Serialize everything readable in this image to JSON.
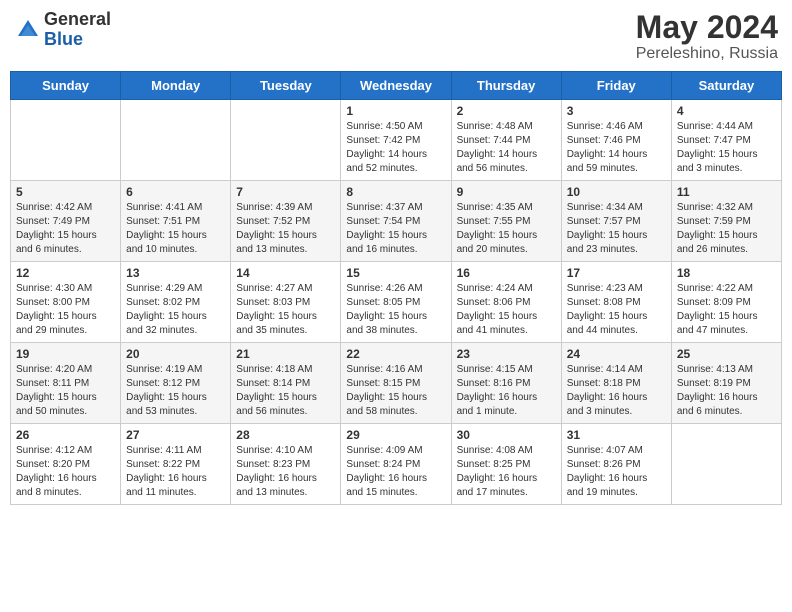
{
  "header": {
    "logo_general": "General",
    "logo_blue": "Blue",
    "title": "May 2024",
    "location": "Pereleshino, Russia"
  },
  "days_of_week": [
    "Sunday",
    "Monday",
    "Tuesday",
    "Wednesday",
    "Thursday",
    "Friday",
    "Saturday"
  ],
  "weeks": [
    [
      {
        "day": "",
        "info": ""
      },
      {
        "day": "",
        "info": ""
      },
      {
        "day": "",
        "info": ""
      },
      {
        "day": "1",
        "info": "Sunrise: 4:50 AM\nSunset: 7:42 PM\nDaylight: 14 hours\nand 52 minutes."
      },
      {
        "day": "2",
        "info": "Sunrise: 4:48 AM\nSunset: 7:44 PM\nDaylight: 14 hours\nand 56 minutes."
      },
      {
        "day": "3",
        "info": "Sunrise: 4:46 AM\nSunset: 7:46 PM\nDaylight: 14 hours\nand 59 minutes."
      },
      {
        "day": "4",
        "info": "Sunrise: 4:44 AM\nSunset: 7:47 PM\nDaylight: 15 hours\nand 3 minutes."
      }
    ],
    [
      {
        "day": "5",
        "info": "Sunrise: 4:42 AM\nSunset: 7:49 PM\nDaylight: 15 hours\nand 6 minutes."
      },
      {
        "day": "6",
        "info": "Sunrise: 4:41 AM\nSunset: 7:51 PM\nDaylight: 15 hours\nand 10 minutes."
      },
      {
        "day": "7",
        "info": "Sunrise: 4:39 AM\nSunset: 7:52 PM\nDaylight: 15 hours\nand 13 minutes."
      },
      {
        "day": "8",
        "info": "Sunrise: 4:37 AM\nSunset: 7:54 PM\nDaylight: 15 hours\nand 16 minutes."
      },
      {
        "day": "9",
        "info": "Sunrise: 4:35 AM\nSunset: 7:55 PM\nDaylight: 15 hours\nand 20 minutes."
      },
      {
        "day": "10",
        "info": "Sunrise: 4:34 AM\nSunset: 7:57 PM\nDaylight: 15 hours\nand 23 minutes."
      },
      {
        "day": "11",
        "info": "Sunrise: 4:32 AM\nSunset: 7:59 PM\nDaylight: 15 hours\nand 26 minutes."
      }
    ],
    [
      {
        "day": "12",
        "info": "Sunrise: 4:30 AM\nSunset: 8:00 PM\nDaylight: 15 hours\nand 29 minutes."
      },
      {
        "day": "13",
        "info": "Sunrise: 4:29 AM\nSunset: 8:02 PM\nDaylight: 15 hours\nand 32 minutes."
      },
      {
        "day": "14",
        "info": "Sunrise: 4:27 AM\nSunset: 8:03 PM\nDaylight: 15 hours\nand 35 minutes."
      },
      {
        "day": "15",
        "info": "Sunrise: 4:26 AM\nSunset: 8:05 PM\nDaylight: 15 hours\nand 38 minutes."
      },
      {
        "day": "16",
        "info": "Sunrise: 4:24 AM\nSunset: 8:06 PM\nDaylight: 15 hours\nand 41 minutes."
      },
      {
        "day": "17",
        "info": "Sunrise: 4:23 AM\nSunset: 8:08 PM\nDaylight: 15 hours\nand 44 minutes."
      },
      {
        "day": "18",
        "info": "Sunrise: 4:22 AM\nSunset: 8:09 PM\nDaylight: 15 hours\nand 47 minutes."
      }
    ],
    [
      {
        "day": "19",
        "info": "Sunrise: 4:20 AM\nSunset: 8:11 PM\nDaylight: 15 hours\nand 50 minutes."
      },
      {
        "day": "20",
        "info": "Sunrise: 4:19 AM\nSunset: 8:12 PM\nDaylight: 15 hours\nand 53 minutes."
      },
      {
        "day": "21",
        "info": "Sunrise: 4:18 AM\nSunset: 8:14 PM\nDaylight: 15 hours\nand 56 minutes."
      },
      {
        "day": "22",
        "info": "Sunrise: 4:16 AM\nSunset: 8:15 PM\nDaylight: 15 hours\nand 58 minutes."
      },
      {
        "day": "23",
        "info": "Sunrise: 4:15 AM\nSunset: 8:16 PM\nDaylight: 16 hours\nand 1 minute."
      },
      {
        "day": "24",
        "info": "Sunrise: 4:14 AM\nSunset: 8:18 PM\nDaylight: 16 hours\nand 3 minutes."
      },
      {
        "day": "25",
        "info": "Sunrise: 4:13 AM\nSunset: 8:19 PM\nDaylight: 16 hours\nand 6 minutes."
      }
    ],
    [
      {
        "day": "26",
        "info": "Sunrise: 4:12 AM\nSunset: 8:20 PM\nDaylight: 16 hours\nand 8 minutes."
      },
      {
        "day": "27",
        "info": "Sunrise: 4:11 AM\nSunset: 8:22 PM\nDaylight: 16 hours\nand 11 minutes."
      },
      {
        "day": "28",
        "info": "Sunrise: 4:10 AM\nSunset: 8:23 PM\nDaylight: 16 hours\nand 13 minutes."
      },
      {
        "day": "29",
        "info": "Sunrise: 4:09 AM\nSunset: 8:24 PM\nDaylight: 16 hours\nand 15 minutes."
      },
      {
        "day": "30",
        "info": "Sunrise: 4:08 AM\nSunset: 8:25 PM\nDaylight: 16 hours\nand 17 minutes."
      },
      {
        "day": "31",
        "info": "Sunrise: 4:07 AM\nSunset: 8:26 PM\nDaylight: 16 hours\nand 19 minutes."
      },
      {
        "day": "",
        "info": ""
      }
    ]
  ]
}
